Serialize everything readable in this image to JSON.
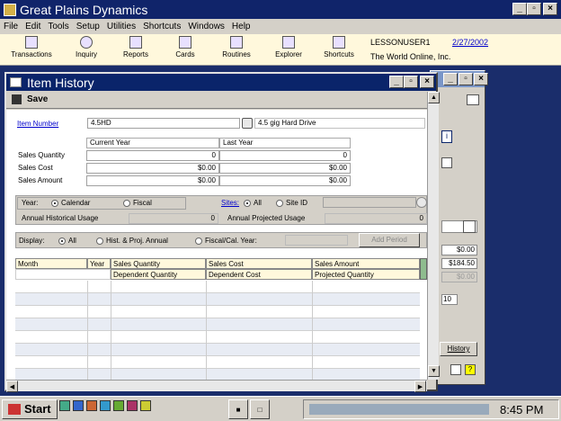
{
  "app": {
    "title": "Great Plains Dynamics"
  },
  "menu": [
    "File",
    "Edit",
    "Tools",
    "Setup",
    "Utilities",
    "Shortcuts",
    "Windows",
    "Help"
  ],
  "toolbar": {
    "items": [
      "Transactions",
      "Inquiry",
      "Reports",
      "Cards",
      "Routines",
      "Explorer",
      "Shortcuts"
    ],
    "user": "LESSONUSER1",
    "company": "The World Online, Inc.",
    "date": "2/27/2002"
  },
  "window": {
    "title": "Item History",
    "save_label": "Save",
    "item_number_label": "Item Number",
    "item_number": "4.5HD",
    "item_description": "4.5 gig Hard Drive",
    "current_year_label": "Current Year",
    "last_year_label": "Last Year",
    "rows": [
      {
        "label": "Sales Quantity",
        "current": "0",
        "last": "0"
      },
      {
        "label": "Sales Cost",
        "current": "$0.00",
        "last": "$0.00"
      },
      {
        "label": "Sales Amount",
        "current": "$0.00",
        "last": "$0.00"
      }
    ],
    "year_label": "Year:",
    "calendar_label": "Calendar",
    "fiscal_label": "Fiscal",
    "sites_label": "Sites:",
    "all_label": "All",
    "site_id_label": "Site ID",
    "annual_hist_label": "Annual Historical Usage",
    "annual_hist_value": "0",
    "annual_proj_label": "Annual Projected Usage",
    "annual_proj_value": "0",
    "display_label": "Display:",
    "display_all": "All",
    "display_hist": "Hist. & Proj. Annual",
    "display_fiscal": "Fiscal/Cal. Year:",
    "add_period": "Add Period",
    "grid": {
      "h1": [
        "Month",
        "Year",
        "Sales Quantity",
        "Sales Cost",
        "Sales Amount"
      ],
      "h2": [
        "Dependent Quantity",
        "Dependent Cost",
        "Projected Quantity"
      ]
    }
  },
  "right_panel": {
    "values": [
      "$0.00",
      "$184.50",
      "$0.00",
      "10"
    ],
    "history_label": "History"
  },
  "taskbar": {
    "start": "Start",
    "clock": "8:45 PM"
  }
}
